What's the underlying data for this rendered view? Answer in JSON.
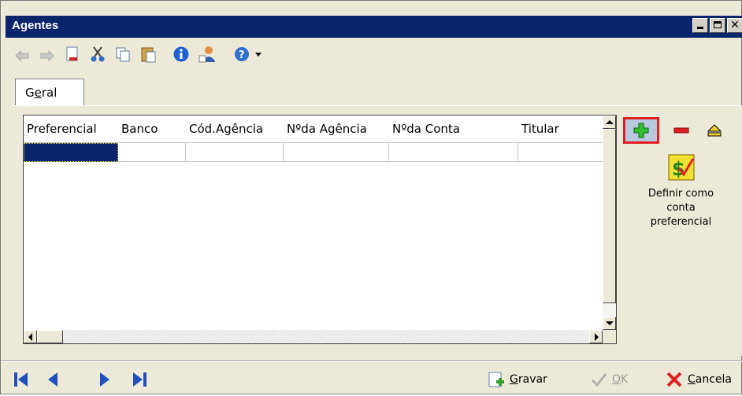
{
  "window": {
    "title": "Agentes"
  },
  "toolbar": {
    "icons": [
      "undo-icon",
      "redo-icon",
      "new-document-icon",
      "cut-icon",
      "copy-icon",
      "paste-icon",
      "info-icon",
      "user-icon",
      "help-dropdown-icon"
    ]
  },
  "tabs": [
    {
      "label_pre": "G",
      "label_u": "e",
      "label_post": "ral"
    }
  ],
  "grid": {
    "columns": [
      "Preferencial",
      "Banco",
      "Cód.Agência",
      "Nºda Agência",
      "Nºda Conta",
      "Titular"
    ],
    "rows": [
      [
        "",
        "",
        "",
        "",
        "",
        ""
      ]
    ]
  },
  "side": {
    "add_icon": "plus-icon",
    "remove_icon": "minus-icon",
    "eject_icon": "eject-icon",
    "preferred_label": "Definir como conta preferencial"
  },
  "footer": {
    "save_u": "G",
    "save_rest": "ravar",
    "ok_u": "O",
    "ok_rest": "K",
    "cancel_u": "C",
    "cancel_rest": "ancela"
  },
  "colors": {
    "titlebar": "#08246b",
    "highlight": "#e02020",
    "selection": "#08246b",
    "nav": "#2050c0"
  }
}
